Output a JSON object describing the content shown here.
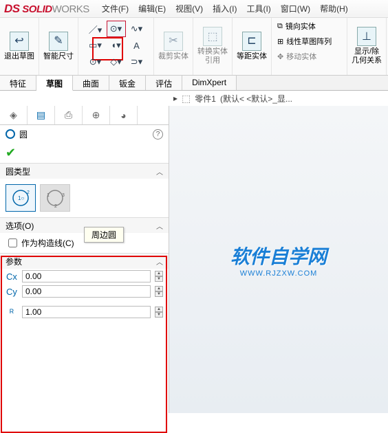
{
  "app": {
    "brand_ds": "DS",
    "brand_solid": "SOLID",
    "brand_works": "WORKS"
  },
  "menu": {
    "file": "文件(F)",
    "edit": "编辑(E)",
    "view": "视图(V)",
    "insert": "插入(I)",
    "tools": "工具(I)",
    "window": "窗口(W)",
    "help": "帮助(H)"
  },
  "ribbon": {
    "exit_sketch": "退出草图",
    "smart_dim": "智能尺寸",
    "trim": "裁剪实体",
    "convert": "转换实体引用",
    "offset": "等距实体",
    "mirror": "镜向实体",
    "linear_pattern": "线性草图阵列",
    "move": "移动实体",
    "display": "显示/除几何关系"
  },
  "tabs": {
    "feature": "特征",
    "sketch": "草图",
    "surface": "曲面",
    "sheetmetal": "钣金",
    "evaluate": "评估",
    "dimxpert": "DimXpert"
  },
  "breadcrumb": {
    "part": "零件1",
    "config": "(默认< <默认>_显..."
  },
  "prop": {
    "title": "圆",
    "sec_type": "圆类型",
    "tooltip": "周边圆",
    "sec_options": "选项(O)",
    "opt_construction": "作为构造线(C)",
    "sec_params": "参数",
    "cx": "0.00",
    "cy": "0.00",
    "r": "1.00"
  },
  "watermark": {
    "line1": "软件自学网",
    "line2": "WWW.RJZXW.COM"
  }
}
